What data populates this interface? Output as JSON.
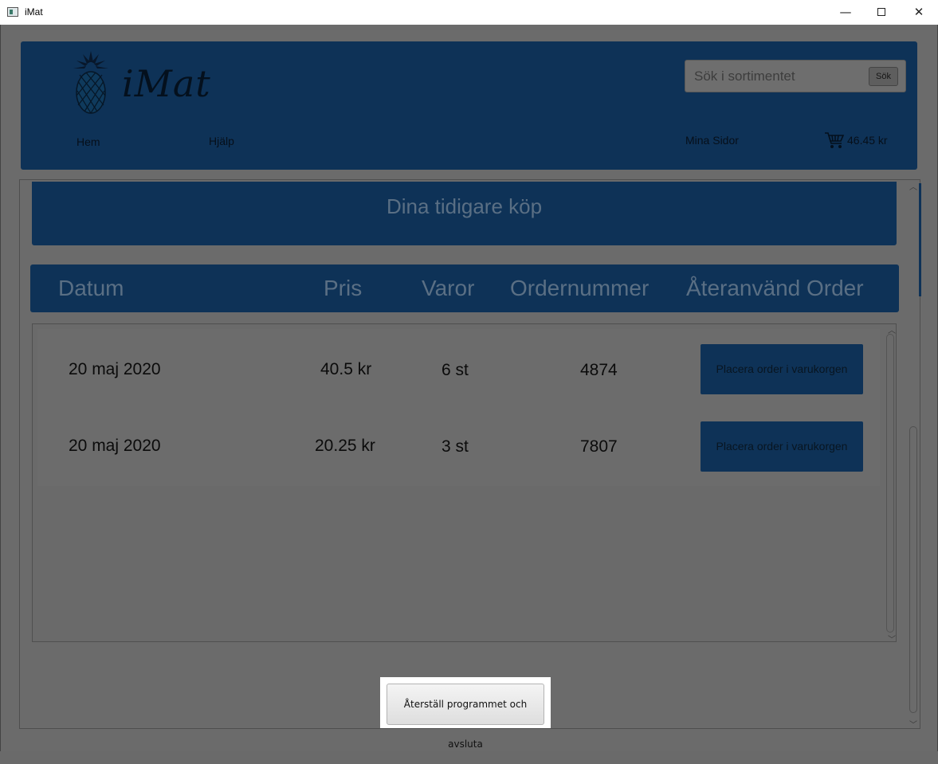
{
  "window": {
    "title": "iMat",
    "minimize_glyph": "—",
    "close_glyph": "✕"
  },
  "header": {
    "logo_text": "iMat",
    "search": {
      "placeholder": "Sök i sortimentet",
      "button_label": "Sök"
    },
    "nav": {
      "home": "Hem",
      "help": "Hjälp",
      "my_pages": "Mina Sidor"
    },
    "cart_total": "46.45 kr"
  },
  "page": {
    "section_title": "Dina tidigare köp",
    "columns": {
      "date": "Datum",
      "price": "Pris",
      "items": "Varor",
      "order_number": "Ordernummer",
      "reuse": "Återanvänd Order"
    },
    "orders": [
      {
        "date": "20 maj 2020",
        "price": "40.5 kr",
        "items": "6 st",
        "order_number": "4874",
        "button_label": "Placera order i varukorgen"
      },
      {
        "date": "20 maj 2020",
        "price": "20.25 kr",
        "items": "3 st",
        "order_number": "7807",
        "button_label": "Placera order i varukorgen"
      }
    ],
    "reset_button_label": "Återställ programmet och avsluta"
  },
  "colors": {
    "brand_blue_dimmed": "#0e3257",
    "overlay_gray": "#6b6b6b"
  }
}
